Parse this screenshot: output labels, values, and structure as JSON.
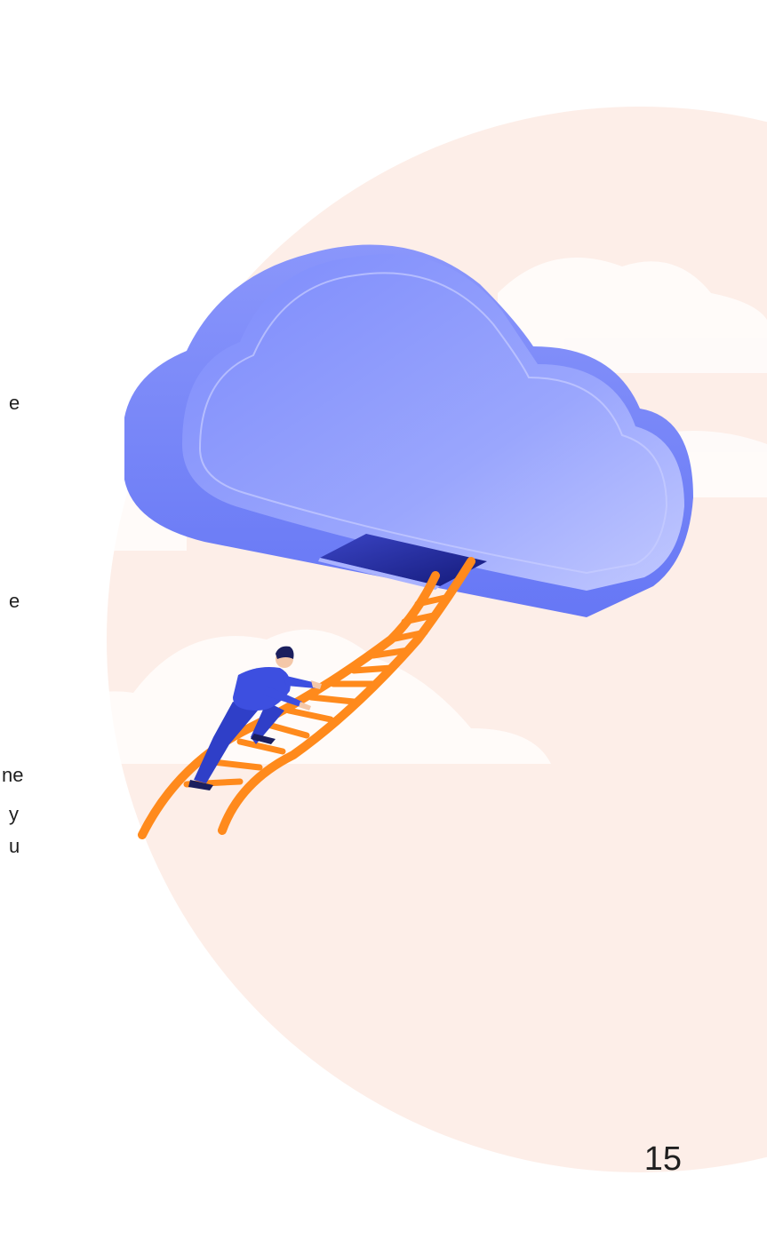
{
  "text_fragments": [
    "e",
    "e",
    "ne",
    "y",
    "u"
  ],
  "page_number": "15",
  "colors": {
    "background_circle": "#fdeee8",
    "cloud_light": "#a3aefc",
    "cloud_dark": "#6e7dfa",
    "hatch": "#2f37b8",
    "ladder": "#ff8a1c",
    "person_shirt": "#3d4fe0",
    "person_hair": "#1b1f5e"
  }
}
